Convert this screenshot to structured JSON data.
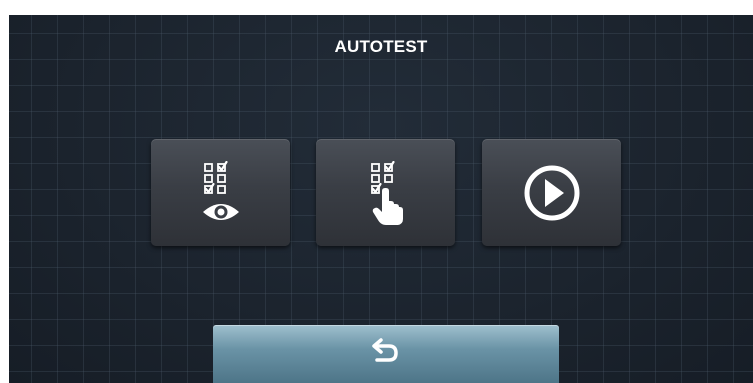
{
  "screen": {
    "title": "AUTOTEST"
  },
  "buttons": [
    {
      "icon": "checklist-eye-icon"
    },
    {
      "icon": "checklist-hand-icon"
    },
    {
      "icon": "play-circle-icon"
    }
  ],
  "footer": {
    "back_icon": "return-arrow-icon"
  },
  "colors": {
    "background": "#1c2530",
    "tile": "#3a3e45",
    "back_button": "#6a93a6",
    "icon": "#ffffff"
  }
}
